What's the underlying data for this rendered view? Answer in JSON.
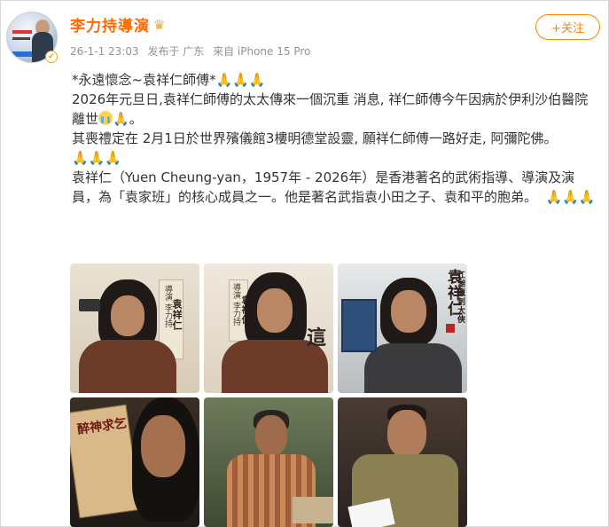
{
  "user": {
    "name": "李力持導演",
    "avatar_icon": "user-avatar",
    "verified_icon": "verified-badge-icon",
    "crown_icon": "crown-icon"
  },
  "meta": {
    "date": "26-1-1 23:03",
    "location": "发布于 广东",
    "device": "来自 iPhone 15 Pro"
  },
  "follow_button": {
    "label": "+关注",
    "color": "#ff8200"
  },
  "post": {
    "line1_text": "*永遠懷念~袁祥仁師傅*",
    "line1_emoji": "🙏🙏🙏",
    "line2_text": "2026年元旦日,袁祥仁師傅的太太傳來一個沉重 消息, 祥仁師傅今午因病於伊利沙伯醫院離世",
    "line2_emoji": "🙏",
    "line2_end": "。",
    "line3_text": "其喪禮定在 2月1日於世界殯儀館3樓明德堂設靈, 願祥仁師傅一路好走, 阿彌陀佛。",
    "line4_emoji": "🙏🙏🙏",
    "line5_text": "袁祥仁（Yuen Cheung-yan，1957年 - 2026年）是香港著名的武術指導、導演及演員，為「袁家班」的核心成員之一。他是著名武指袁小田之子、袁和平的胞弟。",
    "line5_emoji": "🙏🙏🙏"
  },
  "photos": {
    "p1_director_label": "導演 李力持",
    "p1_name_label": "袁祥仁",
    "p2_director_label": "導演 李力持",
    "p2_name_label": "袁祥仁",
    "p2_side_text": "這",
    "p3_title": "袁祥仁",
    "p3_side_label": "江湖獵刺大俠",
    "p4_sign_text": "醉神求乞"
  },
  "colors": {
    "name_orange": "#ff6a00",
    "meta_gray": "#939393",
    "text": "#333333"
  }
}
